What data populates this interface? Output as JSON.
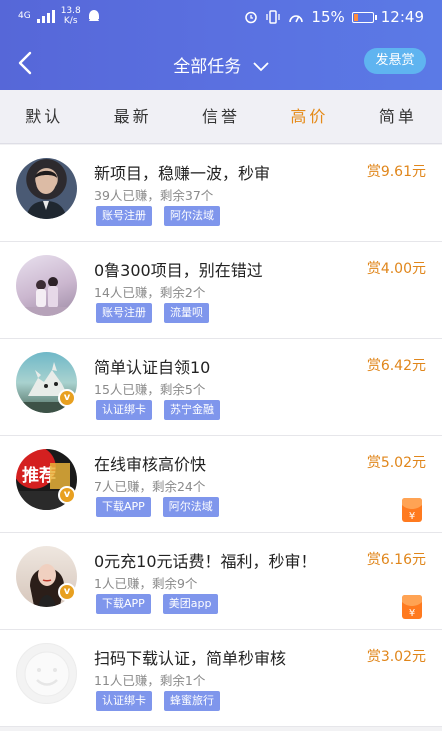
{
  "status": {
    "network": "4G",
    "speed_value": "13.8",
    "speed_unit": "K/s",
    "battery": "15%",
    "time": "12:49",
    "battery_level_pct": 15
  },
  "header": {
    "title": "全部任务",
    "post_button": "发悬赏"
  },
  "tabs": [
    {
      "label": "默认",
      "active": false
    },
    {
      "label": "最新",
      "active": false
    },
    {
      "label": "信誉",
      "active": false
    },
    {
      "label": "高价",
      "active": true
    },
    {
      "label": "简单",
      "active": false
    }
  ],
  "colors": {
    "header_start": "#5667d8",
    "header_end": "#5b7ae6",
    "accent_orange": "#e58a18",
    "tag_blue": "#7f96ec",
    "post_button": "#5fb4f0"
  },
  "tasks": [
    {
      "title": "新项目，稳赚一波，秒审",
      "stats": "39人已赚，剩余37个",
      "tags": [
        "账号注册",
        "阿尔法域"
      ],
      "reward": "赏9.61元",
      "verified": false,
      "redpack": false
    },
    {
      "title": "0鲁300项目，别在错过",
      "stats": "14人已赚，剩余2个",
      "tags": [
        "账号注册",
        "流量呗"
      ],
      "reward": "赏4.00元",
      "verified": false,
      "redpack": false
    },
    {
      "title": "简单认证自领10",
      "stats": "15人已赚，剩余5个",
      "tags": [
        "认证绑卡",
        "苏宁金融"
      ],
      "reward": "赏6.42元",
      "verified": true,
      "redpack": false
    },
    {
      "title": "在线审核高价快",
      "stats": "7人已赚，剩余24个",
      "tags": [
        "下载APP",
        "阿尔法域"
      ],
      "reward": "赏5.02元",
      "verified": true,
      "redpack": true,
      "avatar_text": "推荐"
    },
    {
      "title": "0元充10元话费！福利，秒审！",
      "stats": "1人已赚，剩余9个",
      "tags": [
        "下载APP",
        "美团app"
      ],
      "reward": "赏6.16元",
      "verified": true,
      "redpack": true
    },
    {
      "title": "扫码下载认证，简单秒审核",
      "stats": "11人已赚，剩余1个",
      "tags": [
        "认证绑卡",
        "蜂蜜旅行"
      ],
      "reward": "赏3.02元",
      "verified": false,
      "redpack": false
    }
  ]
}
